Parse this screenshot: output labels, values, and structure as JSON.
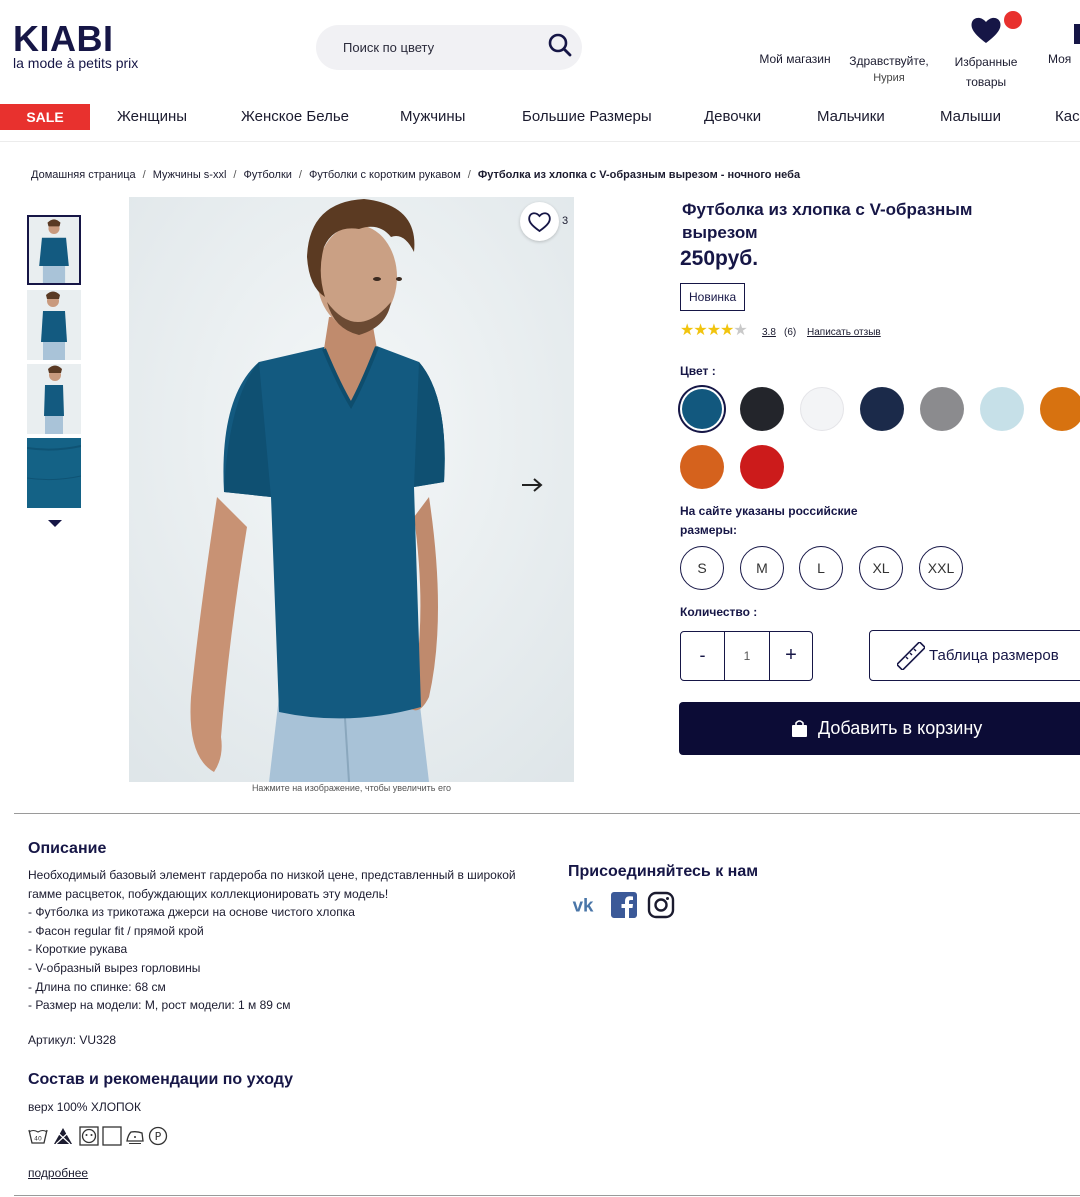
{
  "header": {
    "logo": {
      "name": "KIABI",
      "tagline": "la mode à petits prix"
    },
    "search": {
      "placeholder": "Поиск по цвету"
    },
    "my_store": "Мой магазин",
    "greeting": "Здравствуйте,",
    "user_name": "Нурия",
    "favorites": [
      "Избранные",
      "товары"
    ],
    "account": "Моя"
  },
  "nav": {
    "sale": "SALE",
    "items": [
      "Женщины",
      "Женское Белье",
      "Мужчины",
      "Большие Размеры",
      "Девочки",
      "Мальчики",
      "Малыши",
      "Кас"
    ]
  },
  "breadcrumb": {
    "items": [
      "Домашняя страница",
      "Мужчины s-xxl",
      "Футболки",
      "Футболки с коротким рукавом"
    ],
    "current": "Футболка из хлопка с V-образным вырезом - ночного неба",
    "separator": "/"
  },
  "gallery": {
    "favorites_count": "3",
    "zoom_hint": "Нажмите на изображение, чтобы увеличить его"
  },
  "product": {
    "title": "Футболка из хлопка с V-образным вырезом",
    "price": "250руб.",
    "badge": "Новинка",
    "rating": {
      "value": "3.8",
      "stars": 3.8,
      "max": 5,
      "count": "(6)",
      "write_review": "Написать отзыв"
    },
    "color_label": "Цвет :",
    "colors": [
      "#12587e",
      "#23252b",
      "#f3f4f6",
      "#1b2a4a",
      "#8b8b8e",
      "#c6e0e8",
      "#d77210",
      "#d5621d",
      "#cc1b1b"
    ],
    "selected_color": 0,
    "size_note": "На сайте указаны российские размеры:",
    "sizes": [
      "S",
      "M",
      "L",
      "XL",
      "XXL"
    ],
    "quantity_label": "Количество :",
    "quantity": {
      "minus": "-",
      "value": "1",
      "plus": "+"
    },
    "size_table": "Таблица размеров",
    "add_to_cart": "Добавить в корзину"
  },
  "description": {
    "title": "Описание",
    "lines": [
      "Необходимый базовый элемент гардероба по низкой цене, представленный в широкой гамме расцветок, побуждающих коллекционировать эту модель!",
      "- Футболка из трикотажа джерси на основе чистого хлопка",
      "- Фасон regular fit / прямой крой",
      "- Короткие рукава",
      "- V-образный вырез горловины",
      "- Длина по спинке: 68 см",
      "- Размер на модели: M, рост модели: 1 м 89 см"
    ],
    "sku": "Артикул: VU328"
  },
  "composition": {
    "title": "Состав и рекомендации по уходу",
    "text": "верх 100% ХЛОПОК",
    "care_icons": [
      "wash-40-icon",
      "no-bleach-icon",
      "tumble-dry-icon",
      "dry-flat-icon",
      "iron-icon",
      "dry-clean-p-icon"
    ],
    "more": "подробнее"
  },
  "social": {
    "title": "Присоединяйтесь к нам",
    "networks": [
      "vk-icon",
      "facebook-icon",
      "instagram-icon"
    ]
  },
  "colors": {
    "brand": "#161646",
    "sale": "#e8312e",
    "cta": "#0c0c36",
    "star": "#f1c40f"
  }
}
